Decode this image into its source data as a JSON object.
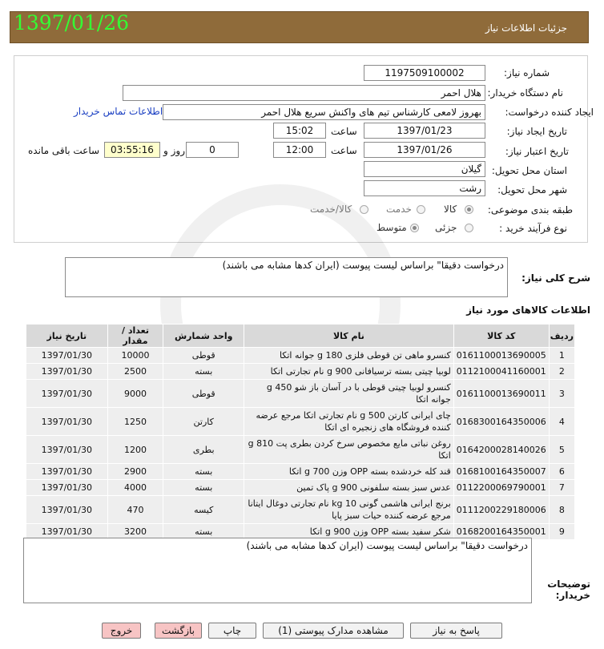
{
  "header": {
    "date": "1397/01/26",
    "title": "جزئیات اطلاعات نیاز"
  },
  "form": {
    "need_number_label": "شماره نیاز:",
    "need_number": "1197509100002",
    "buyer_org_label": "نام دستگاه خریدار:",
    "buyer_org": "هلال احمر",
    "creator_label": "ایجاد کننده درخواست:",
    "creator": "بهروز  لامعی کارشناس تیم های واکنش سریع هلال احمر",
    "contact_link": "اطلاعات تماس خریدار",
    "created_date_label": "تاریخ ایجاد نیاز:",
    "created_date": "1397/01/23",
    "time_label": "ساعت",
    "created_time": "15:02",
    "valid_date_label": "تاریخ اعتبار نیاز:",
    "valid_date": "1397/01/26",
    "valid_time": "12:00",
    "days_value": "0",
    "days_label": "روز و",
    "remaining_time": "03:55:16",
    "remaining_label": "ساعت باقی مانده",
    "province_label": "استان محل تحویل:",
    "province": "گیلان",
    "city_label": "شهر محل تحویل:",
    "city": "رشت",
    "category_label": "طبقه بندی موضوعی:",
    "category_options": [
      "کالا",
      "خدمت",
      "کالا/خدمت"
    ],
    "process_label": "نوع فرآیند خرید :",
    "process_options": [
      "جزئی",
      "متوسط"
    ]
  },
  "summary": {
    "label": "شرح کلی نیاز:",
    "text": "درخواست دقیقا\" براساس لیست پیوست (ایران کدها مشابه می باشند)"
  },
  "items_section_title": "اطلاعات کالاهای مورد نیاز",
  "table": {
    "headers": [
      "ردیف",
      "کد کالا",
      "نام کالا",
      "واحد شمارش",
      "تعداد / مقدار",
      "تاریخ نیاز"
    ],
    "rows": [
      [
        "1",
        "0161100013690005",
        "کنسرو ماهی تن قوطی فلزی 180 g جوانه اتکا",
        "قوطی",
        "10000",
        "1397/01/30"
      ],
      [
        "2",
        "0112100041160001",
        "لوبیا چیتی بسته ترسیافانی 900 g نام تجارتی اتکا",
        "بسته",
        "2500",
        "1397/01/30"
      ],
      [
        "3",
        "0161100013690011",
        "کنسرو لوبیا چیتی قوطی با در آسان باز شو 450 g جوانه اتکا",
        "قوطی",
        "9000",
        "1397/01/30"
      ],
      [
        "4",
        "0168300164350006",
        "چای ایرانی کارتن 500 g نام تجارتی اتکا مرجع عرضه کننده فروشگاه های زنجیره ای اتکا",
        "کارتن",
        "1250",
        "1397/01/30"
      ],
      [
        "5",
        "0164200028140026",
        "روغن نباتی مایع مخصوص سرخ کردن بطری پت 810 g اتکا",
        "بطری",
        "1200",
        "1397/01/30"
      ],
      [
        "6",
        "0168100164350007",
        "قند کله خردشده بسته OPP وزن 700 g اتکا",
        "بسته",
        "2900",
        "1397/01/30"
      ],
      [
        "7",
        "0112200069790001",
        "عدس سبز بسته سلفونی 900 g پاک تمین",
        "بسته",
        "4000",
        "1397/01/30"
      ],
      [
        "8",
        "0111200229180006",
        "برنج ایرانی هاشمی گونی 10 kg نام تجارتی دوغال ایتانا مرجع عرضه کننده حیات سبز پایا",
        "کیسه",
        "470",
        "1397/01/30"
      ],
      [
        "9",
        "0168200164350001",
        "شکر سفید بسته OPP وزن 900 g اتکا",
        "بسته",
        "3200",
        "1397/01/30"
      ]
    ]
  },
  "buyer_notes": {
    "label": "توضیحات خریدار:",
    "text": "درخواست دقیقا\" براساس لیست پیوست (ایران کدها مشابه می باشند)"
  },
  "buttons": {
    "reply": "پاسخ به نیاز",
    "attachments": "مشاهده مدارک پیوستی (1)",
    "print": "چاپ",
    "back": "بازگشت",
    "exit": "خروج"
  }
}
